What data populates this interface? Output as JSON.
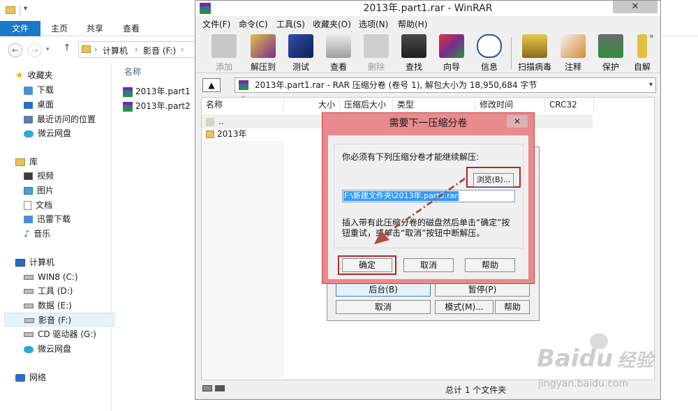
{
  "explorer": {
    "ribbon_tabs": [
      "文件",
      "主页",
      "共享",
      "查看"
    ],
    "breadcrumb": [
      "计算机",
      "影音 (F:)"
    ],
    "nav": {
      "favorites": "收藏夹",
      "favorite_items": [
        "下载",
        "桌面",
        "最近访问的位置",
        "微云网盘"
      ],
      "libraries": "库",
      "library_items": [
        "视频",
        "图片",
        "文档",
        "迅雷下载",
        "音乐"
      ],
      "computer": "计算机",
      "drives": [
        "WIN8 (C:)",
        "工具 (D:)",
        "数据 (E:)",
        "影音 (F:)",
        "CD 驱动器 (G:)",
        "微云网盘"
      ],
      "network": "网络"
    },
    "column_name": "名称",
    "files": [
      "2013年.part1",
      "2013年.part2"
    ]
  },
  "winrar": {
    "title": "2013年.part1.rar - WinRAR",
    "menu": [
      "文件(F)",
      "命令(C)",
      "工具(S)",
      "收藏夹(O)",
      "选项(N)",
      "帮助(H)"
    ],
    "toolbar": [
      "添加",
      "解压到",
      "测试",
      "查看",
      "删除",
      "查找",
      "向导",
      "信息",
      "扫描病毒",
      "注释",
      "保护",
      "自解"
    ],
    "path": "2013年.part1.rar - RAR 压缩分卷 (卷号 1), 解包大小为 18,950,684 字节",
    "columns": [
      "名称",
      "大小",
      "压缩后大小",
      "类型",
      "修改时间",
      "CRC32"
    ],
    "rows": [
      "..",
      "2013年"
    ],
    "status": "总计 1 个文件夹"
  },
  "progress_dialog": {
    "buttons": [
      "后台(B)",
      "暂停(P)",
      "取消",
      "模式(M)...",
      "帮助"
    ]
  },
  "next_volume_dialog": {
    "title": "需要下一压缩分卷",
    "message": "你必须有下列压缩分卷才能继续解压:",
    "browse": "浏览(B)...",
    "path_value": "F:\\新建文件夹\\2013年.part3.rar",
    "hint": "插入带有此压缩分卷的磁盘然后单击“确定”按钮重试，或单击“取消”按钮中断解压。",
    "ok": "确定",
    "cancel": "取消",
    "help": "帮助"
  },
  "watermark": {
    "brand": "Baidu",
    "cn": "经验",
    "url": "jingyan.baidu.com"
  },
  "colors": {
    "explorer_file_tab": "#1979ca",
    "dialog_frame": "#e98a8d",
    "highlight_box": "#b3262c",
    "arrow": "#a8514a"
  }
}
